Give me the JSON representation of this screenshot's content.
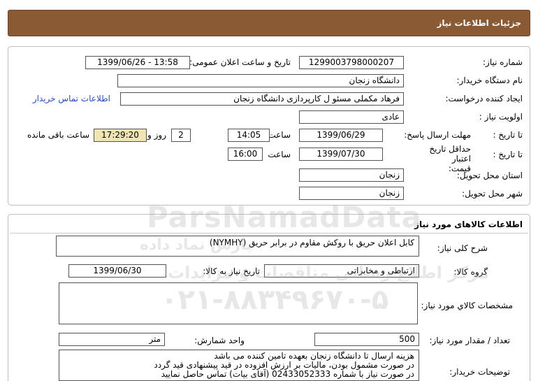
{
  "header": {
    "title": "جزئیات اطلاعات نیاز"
  },
  "need_info": {
    "need_number_label": "شماره نیاز:",
    "need_number": "1299003798000207",
    "announce_label": "تاریخ و ساعت اعلان عمومی:",
    "announce_value": "1399/06/26 - 13:58",
    "buyer_org_label": "نام دستگاه خریدار:",
    "buyer_org": "دانشگاه زنجان",
    "requester_label": "ایجاد کننده درخواست:",
    "requester": "فرهاد مکملی مسئو ل کارپردازی دانشگاه زنجان",
    "contact_link": "اطلاعات تماس خریدار",
    "priority_label": "اولویت نیاز :",
    "priority": "عادی",
    "reply_deadline_label": "مهلت ارسال پاسخ:",
    "until_date_label": "تا تاریخ :",
    "reply_date": "1399/06/29",
    "time_label": "ساعت",
    "reply_time": "14:05",
    "days_value": "2",
    "days_label": "روز و",
    "remaining_time": "17:29:20",
    "remaining_label": "ساعت باقی مانده",
    "price_validity_label": "حداقل تاریخ اعتبار قیمت:",
    "validity_until_label": "تا تاریخ :",
    "validity_date": "1399/07/30",
    "validity_time_label": "ساعت",
    "validity_time": "16:00",
    "province_label": "استان محل تحویل:",
    "province": "زنجان",
    "city_label": "شهر محل تحویل:",
    "city": "زنجان"
  },
  "goods": {
    "section_title": "اطلاعات کالاهای مورد نیاز",
    "description_label": "شرح کلی نیاز:",
    "description": "کابل اعلان حریق با روکش مقاوم در برابر حریق (NYMHY)",
    "group_label": "گروه کالا:",
    "group": "ارتباطی و مخابراتی",
    "need_date_label": "تاریخ نیاز به کالا:",
    "need_date": "1399/06/30",
    "specs_label": "مشخصات کالاي مورد نياز:",
    "specs": "",
    "quantity_label": "تعداد / مقدار مورد نیاز:",
    "quantity": "500",
    "unit_label": "واحد شمارش:",
    "unit": "متر",
    "buyer_notes_label": "توضیحات خریدار:",
    "buyer_notes": [
      "هزینه ارسال تا دانشگاه زنجان بعهده تامین کننده می باشد",
      "در صورت مشمول بودن، مالیات بر ارزش افزوده در قید پیشنهادی قید گردد",
      "در صورت نیاز با شماره 02433052333 (آقای بیات) تماس حاصل نمایید"
    ]
  },
  "watermark": {
    "brand": "ParsNamadData",
    "persian": "پارس نماد داده",
    "tagline": "مرکز اطلاع رسانی مناقصات و مزایدات",
    "phone": "۰۲۱-۸۸۳۴۹۶۷۰-۵"
  }
}
